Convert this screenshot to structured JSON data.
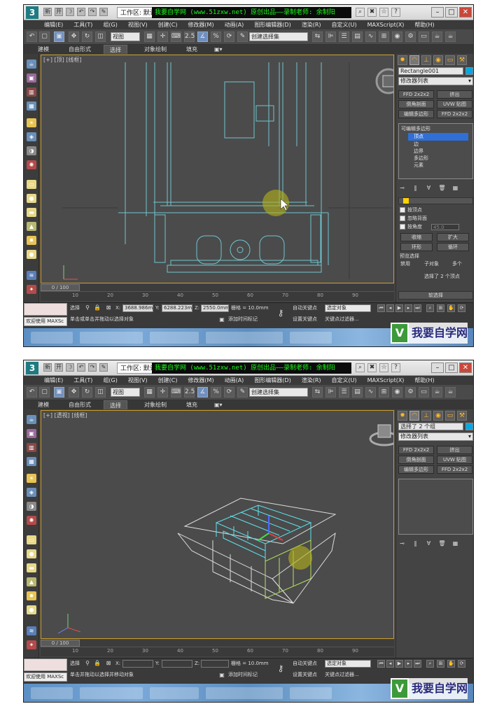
{
  "app": {
    "logo_text": "3",
    "quick_icons": [
      "新",
      "开",
      "☽",
      "↶",
      "↷",
      "✎"
    ],
    "workspace_label": "工作区: 默认",
    "banner": "我要自学网 (www.51zxw.net) 原创出品——录制老师: 余制阳",
    "window_controls": [
      "–",
      "□",
      "✕"
    ]
  },
  "menu": [
    "编辑(E)",
    "工具(T)",
    "组(G)",
    "视图(V)",
    "创建(C)",
    "修改器(M)",
    "动画(A)",
    "图形编辑器(D)",
    "渲染(R)",
    "自定义(U)",
    "MAXScript(X)",
    "帮助(H)"
  ],
  "toolbar": {
    "view_combo": "视图",
    "selection_set": "创建选择集",
    "snap_labels": [
      "2.5",
      "%",
      "⟳"
    ]
  },
  "ribbon": {
    "tabs": [
      "建模",
      "自由形式",
      "选择",
      "对象绘制",
      "填充"
    ],
    "active": "选择"
  },
  "screens": [
    {
      "viewport_label": "[+] [顶] [线框]",
      "object_name": "Rectangle001",
      "modifier_list": "修改器列表",
      "buttons": [
        "FFD 2x2x2",
        "挤出",
        "倒角剖面",
        "UVW 贴图",
        "编辑多边形",
        "FFD 2x2x2"
      ],
      "stack": {
        "root": "可编辑多边形",
        "items": [
          "顶点",
          "边",
          "边界",
          "多边形",
          "元素"
        ],
        "selected": "顶点"
      },
      "selection_rollout": {
        "checks": [
          "按顶点",
          "忽略背面",
          "按角度"
        ],
        "angle_value": "45.0",
        "buttons": [
          "收缩",
          "扩大",
          "环形",
          "循环"
        ],
        "preview_label": "预览选择",
        "radios": [
          "禁用",
          "子对象",
          "多个"
        ],
        "status": "选择了 2 个顶点",
        "soft_selection": "软选择"
      },
      "frame": "0 / 100",
      "status": {
        "select_label": "选择",
        "x": "3688.986m",
        "y": "6288.223m",
        "z": "2550.0mm",
        "grid": "栅格 = 10.0mm",
        "prompt": "单击或单击并拖动以选择对象",
        "add_time_tag": "添加时间标记",
        "auto_key": "自动关键点",
        "set_key": "设置关键点",
        "key_mode": "选定对象",
        "key_filters": "关键点过滤器...",
        "welcome": "欢迎使用 MAXSc"
      }
    },
    {
      "viewport_label": "[+] [透视] [线框]",
      "object_name": "选择了 2 个组",
      "modifier_list": "修改器列表",
      "buttons": [
        "FFD 2x2x2",
        "挤出",
        "倒角剖面",
        "UVW 贴图",
        "编辑多边形",
        "FFD 2x2x2"
      ],
      "frame": "0 / 100",
      "status": {
        "select_label": "选择",
        "x": "",
        "y": "",
        "z": "",
        "grid": "栅格 = 10.0mm",
        "prompt": "单击并拖动以选择并移动对象",
        "add_time_tag": "添加时间标记",
        "auto_key": "自动关键点",
        "set_key": "设置关键点",
        "key_mode": "选定对象",
        "key_filters": "关键点过滤器...",
        "welcome": "欢迎使用 MAXSc"
      }
    }
  ],
  "timeline_ticks": [
    "10",
    "20",
    "30",
    "40",
    "50",
    "60",
    "70",
    "80",
    "90"
  ],
  "watermark": {
    "logo": "V",
    "text": "我要自学网"
  },
  "colors": {
    "accent": "#c89c2d",
    "selection_blue": "#2f6fd6",
    "banner_text": "#19ff19",
    "wire_cyan": "#5ee3f0"
  }
}
